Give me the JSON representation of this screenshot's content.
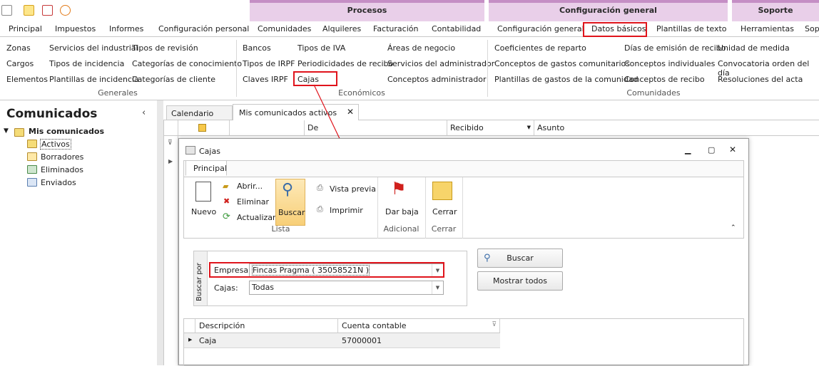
{
  "groups": {
    "procesos": "Procesos",
    "config": "Configuración general",
    "soporte": "Soporte"
  },
  "tabs": [
    "Principal",
    "Impuestos",
    "Informes",
    "Configuración personal",
    "Comunidades",
    "Alquileres",
    "Facturación",
    "Contabilidad",
    "Configuración general",
    "Datos básicos",
    "Plantillas de texto",
    "Herramientas",
    "Sop"
  ],
  "ribbon": {
    "generales": {
      "col1": [
        "Zonas",
        "Cargos",
        "Elementos"
      ],
      "col2": [
        "Servicios del industrial",
        "Tipos de incidencia",
        "Plantillas de incidencia"
      ],
      "col3": [
        "Tipos de revisión",
        "Categorías de conocimiento",
        "Categorías de cliente"
      ],
      "label": "Generales"
    },
    "economicos": {
      "col1": [
        "Bancos",
        "Tipos de IRPF",
        "Claves IRPF"
      ],
      "col2": [
        "Tipos de IVA",
        "Periodicidades de recibo",
        "Cajas"
      ],
      "col3": [
        "Áreas de negocio",
        "Servicios del administrador",
        "Conceptos administrador"
      ],
      "label": "Económicos"
    },
    "comunidades": {
      "col1": [
        "Coeficientes de reparto",
        "Conceptos de gastos comunitarios",
        "Plantillas de gastos de la comunidad"
      ],
      "col2": [
        "Días de emisión de recibo",
        "Conceptos individuales",
        "Conceptos de recibo"
      ],
      "col3": [
        "Unidad de medida",
        "Convocatoria orden del día",
        "Resoluciones del acta"
      ],
      "label": "Comunidades"
    }
  },
  "left": {
    "title": "Comunicados",
    "root": "Mis comunicados",
    "items": [
      "Activos",
      "Borradores",
      "Eliminados",
      "Enviados"
    ]
  },
  "doctabs": {
    "calendar": "Calendario",
    "active": "Mis comunicados activos"
  },
  "grid": {
    "de": "De",
    "recibido": "Recibido",
    "asunto": "Asunto"
  },
  "dialog": {
    "title": "Cajas",
    "tab": "Principal",
    "actions": {
      "nuevo": "Nuevo",
      "abrir": "Abrir...",
      "eliminar": "Eliminar",
      "actualizar": "Actualizar",
      "buscar": "Buscar",
      "vista": "Vista previa",
      "imprimir": "Imprimir",
      "darbaja": "Dar baja",
      "cerrar": "Cerrar"
    },
    "groups": {
      "lista": "Lista",
      "adicional": "Adicional",
      "cerrar": "Cerrar"
    },
    "search": {
      "vertical": "Buscar por",
      "empresa_label": "Empresa:",
      "empresa_value": "Fincas Pragma ( 35058521N )",
      "cajas_label": "Cajas:",
      "cajas_value": "Todas"
    },
    "buttons": {
      "buscar": "Buscar",
      "mostrar": "Mostrar todos"
    },
    "table": {
      "headers": [
        "Descripción",
        "Cuenta contable"
      ],
      "rows": [
        {
          "descripcion": "Caja",
          "cuenta": "57000001"
        }
      ]
    }
  },
  "colors": {
    "accent": "#e0141c",
    "group_bg": "#e9cfe9"
  }
}
